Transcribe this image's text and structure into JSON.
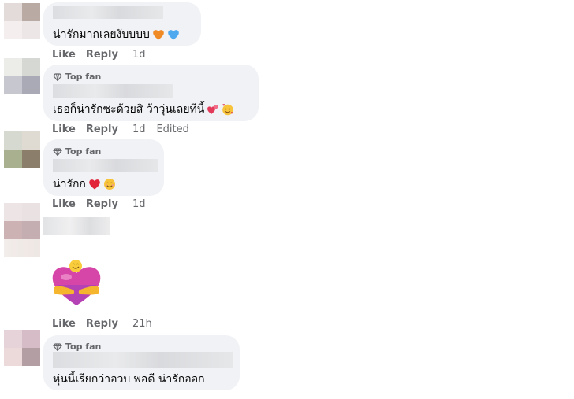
{
  "colors": {
    "bubble_bg": "#f0f2f5",
    "meta_text": "#65676b",
    "text": "#050505"
  },
  "comments": [
    {
      "top_fan": false,
      "text": "น่ารักมากเลยงับบบบ",
      "emojis": [
        "orange-heart-icon",
        "blue-heart-icon"
      ],
      "actions": {
        "like": "Like",
        "reply": "Reply",
        "time": "1d",
        "edited": ""
      }
    },
    {
      "top_fan": true,
      "badge": "Top fan",
      "text": "เธอก็น่ารักซะด้วยสิ ว้าวุ่นเลยทีนี้",
      "emojis": [
        "two-hearts-icon",
        "smiling-face-with-hearts-icon"
      ],
      "actions": {
        "like": "Like",
        "reply": "Reply",
        "time": "1d",
        "edited": "Edited"
      }
    },
    {
      "top_fan": true,
      "badge": "Top fan",
      "text": "น่ารักก",
      "emojis": [
        "red-heart-icon",
        "smiling-face-icon"
      ],
      "actions": {
        "like": "Like",
        "reply": "Reply",
        "time": "1d",
        "edited": ""
      }
    },
    {
      "top_fan": false,
      "sticker": "hug-heart-sticker",
      "actions": {
        "like": "Like",
        "reply": "Reply",
        "time": "21h",
        "edited": ""
      }
    },
    {
      "top_fan": true,
      "badge": "Top fan",
      "text": "หุ่นนี้เรียกว่าอวบ พอดี น่ารักออก",
      "emojis": []
    }
  ]
}
